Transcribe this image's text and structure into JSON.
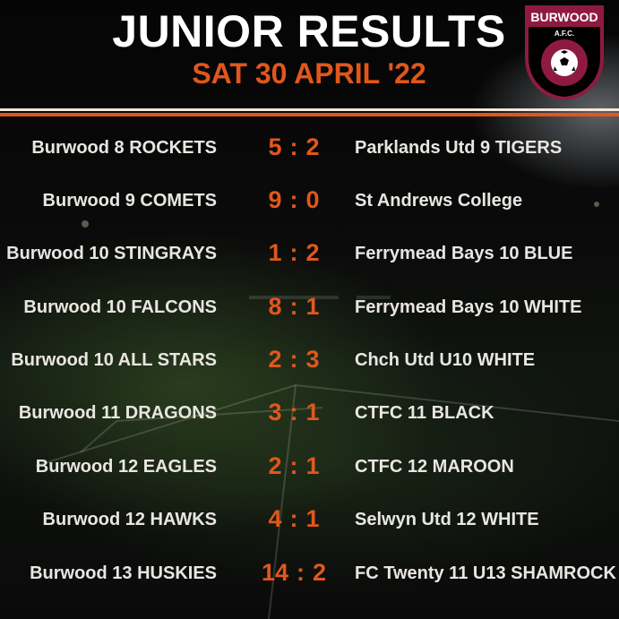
{
  "header": {
    "title": "JUNIOR RESULTS",
    "date": "SAT 30 APRIL '22"
  },
  "logo": {
    "name": "BURWOOD",
    "sub": "A.F.C.",
    "colors": {
      "maroon": "#8e1b3f",
      "white": "#ffffff"
    }
  },
  "colors": {
    "accent": "#e0571c",
    "text": "#e9e6e2"
  },
  "results": [
    {
      "home": "Burwood 8 ROCKETS",
      "home_score": "5",
      "away_score": "2",
      "away": "Parklands Utd 9 TIGERS"
    },
    {
      "home": "Burwood 9 COMETS",
      "home_score": "9",
      "away_score": "0",
      "away": "St Andrews College"
    },
    {
      "home": "Burwood 10 STINGRAYS",
      "home_score": "1",
      "away_score": "2",
      "away": "Ferrymead Bays 10 BLUE"
    },
    {
      "home": "Burwood 10 FALCONS",
      "home_score": "8",
      "away_score": "1",
      "away": "Ferrymead Bays 10 WHITE"
    },
    {
      "home": "Burwood 10 ALL STARS",
      "home_score": "2",
      "away_score": "3",
      "away": "Chch Utd U10 WHITE"
    },
    {
      "home": "Burwood 11 DRAGONS",
      "home_score": "3",
      "away_score": "1",
      "away": "CTFC 11 BLACK"
    },
    {
      "home": "Burwood 12 EAGLES",
      "home_score": "2",
      "away_score": "1",
      "away": "CTFC 12 MAROON"
    },
    {
      "home": "Burwood 12 HAWKS",
      "home_score": "4",
      "away_score": "1",
      "away": "Selwyn Utd 12 WHITE"
    },
    {
      "home": "Burwood 13 HUSKIES",
      "home_score": "14",
      "away_score": "2",
      "away": "FC Twenty 11 U13 SHAMROCK"
    }
  ]
}
